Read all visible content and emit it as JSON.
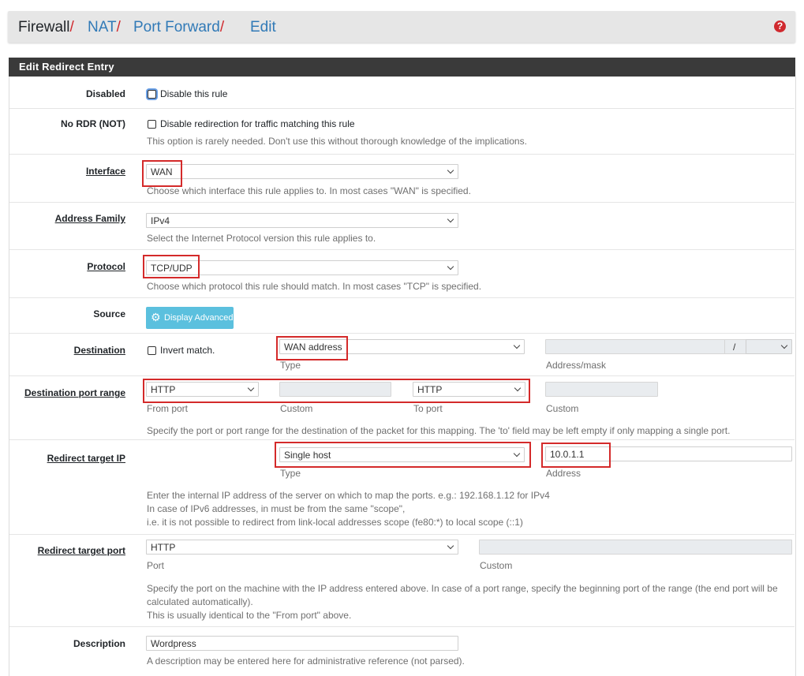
{
  "breadcrumb": {
    "items": [
      "Firewall",
      "NAT",
      "Port Forward",
      "Edit"
    ],
    "separator": "/"
  },
  "panel": {
    "title": "Edit Redirect Entry"
  },
  "disabled": {
    "label": "Disabled",
    "checkbox_label": "Disable this rule",
    "checked": false
  },
  "nordr": {
    "label": "No RDR (NOT)",
    "checkbox_label": "Disable redirection for traffic matching this rule",
    "help": "This option is rarely needed. Don't use this without thorough knowledge of the implications.",
    "checked": false
  },
  "interface": {
    "label": "Interface",
    "value": "WAN",
    "help": "Choose which interface this rule applies to. In most cases \"WAN\" is specified."
  },
  "address_family": {
    "label": "Address Family",
    "value": "IPv4",
    "help": "Select the Internet Protocol version this rule applies to."
  },
  "protocol": {
    "label": "Protocol",
    "value": "TCP/UDP",
    "help": "Choose which protocol this rule should match. In most cases \"TCP\" is specified."
  },
  "source": {
    "label": "Source",
    "button_label": "Display Advanced"
  },
  "destination": {
    "label": "Destination",
    "invert_label": "Invert match.",
    "type_value": "WAN address",
    "type_caption": "Type",
    "address_caption": "Address/mask",
    "mask_sep": "/"
  },
  "dest_port": {
    "label": "Destination port range",
    "from_value": "HTTP",
    "from_caption": "From port",
    "from_custom_caption": "Custom",
    "to_value": "HTTP",
    "to_caption": "To port",
    "to_custom_caption": "Custom",
    "help": "Specify the port or port range for the destination of the packet for this mapping. The 'to' field may be left empty if only mapping a single port."
  },
  "redirect_ip": {
    "label": "Redirect target IP",
    "type_value": "Single host",
    "type_caption": "Type",
    "address_value": "10.0.1.1",
    "address_caption": "Address",
    "help1": "Enter the internal IP address of the server on which to map the ports. e.g.: 192.168.1.12 for IPv4",
    "help2": "In case of IPv6 addresses, in must be from the same \"scope\",",
    "help3": "i.e. it is not possible to redirect from link-local addresses scope (fe80:*) to local scope (::1)"
  },
  "redirect_port": {
    "label": "Redirect target port",
    "value": "HTTP",
    "port_caption": "Port",
    "custom_caption": "Custom",
    "help1": "Specify the port on the machine with the IP address entered above. In case of a port range, specify the beginning port of the range (the end port will be",
    "help2": "calculated automatically).",
    "help3": "This is usually identical to the \"From port\" above."
  },
  "description": {
    "label": "Description",
    "value": "Wordpress",
    "help": "A description may be entered here for administrative reference (not parsed)."
  },
  "colors": {
    "breadcrumb_link": "#317ab7",
    "separator": "#d0292e",
    "panel_header": "#3a3a3a",
    "info_button": "#5bc0de",
    "highlight": "#d42a2a"
  }
}
